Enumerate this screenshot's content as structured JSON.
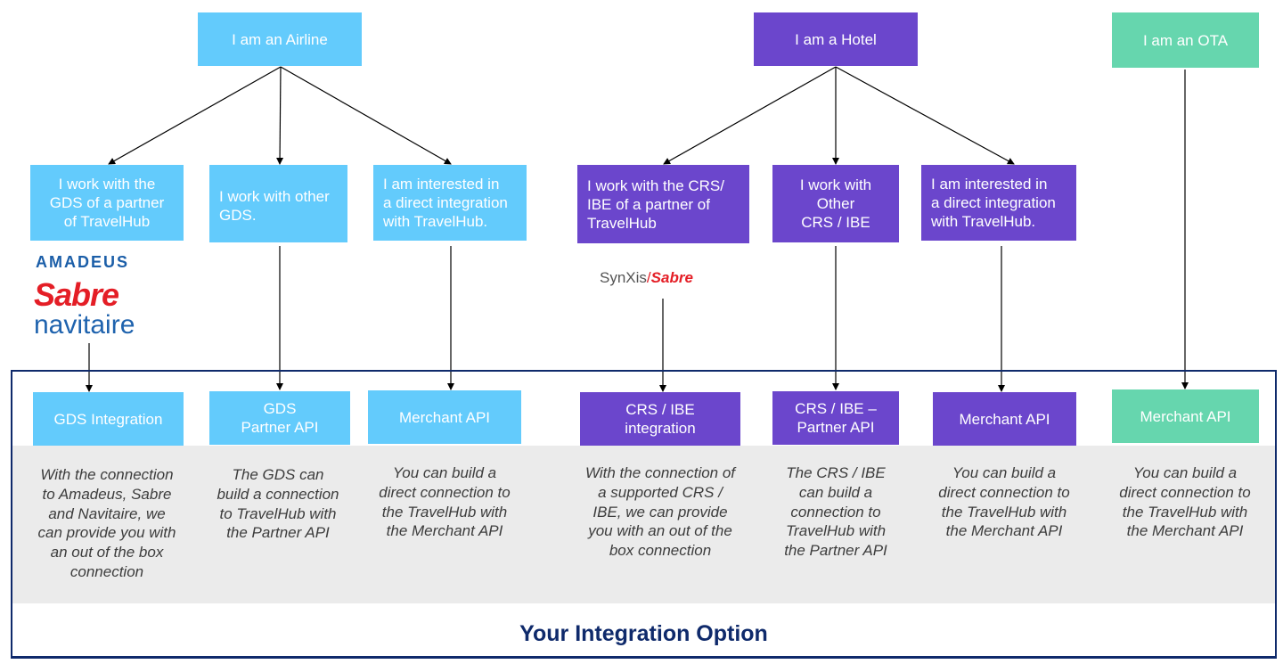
{
  "colors": {
    "airline": "#63cbfc",
    "hotel": "#6b46cc",
    "ota": "#66d6ae",
    "panel": "#ebebeb",
    "frame": "#0f2a6b",
    "logo_red": "#e41e26",
    "logo_blue": "#1b5ea8"
  },
  "roots": {
    "airline": "I am an Airline",
    "hotel": "I am a Hotel",
    "ota": "I am an OTA"
  },
  "situations": {
    "airline_partner_gds": [
      "I work with the",
      "GDS of a partner",
      "of TravelHub"
    ],
    "airline_other_gds": [
      "I work with other",
      "GDS."
    ],
    "airline_direct": [
      "I am interested in",
      "a direct integration",
      "with TravelHub."
    ],
    "hotel_partner_crs": [
      "I work with the CRS/",
      "IBE of a partner of",
      "TravelHub"
    ],
    "hotel_other_crs": [
      "I work with",
      "Other",
      "CRS / IBE"
    ],
    "hotel_direct": [
      "I am interested in",
      "a direct integration",
      "with TravelHub."
    ]
  },
  "logos": {
    "amadeus": "amadeus",
    "sabre": "Sabre",
    "navitaire": "navitaire",
    "synxis": "SynXis",
    "synxis_slash": "/",
    "synxis_sabre": "Sabre"
  },
  "options": [
    {
      "title": [
        "GDS Integration"
      ],
      "description": [
        "With the connection",
        "to Amadeus, Sabre",
        "and Navitaire, we",
        "can provide you with",
        "an out of the box",
        "connection"
      ]
    },
    {
      "title": [
        "GDS",
        "Partner API"
      ],
      "description": [
        "The GDS can",
        "build a connection",
        "to TravelHub with",
        "the Partner API"
      ]
    },
    {
      "title": [
        "Merchant API"
      ],
      "description": [
        "You can build a",
        "direct connection to",
        "the TravelHub with",
        "the Merchant API"
      ]
    },
    {
      "title": [
        "CRS / IBE",
        "integration"
      ],
      "description": [
        "With the connection of",
        "a supported CRS /",
        "IBE, we can provide",
        "you with an out of the",
        "box connection"
      ]
    },
    {
      "title": [
        "CRS / IBE –",
        "Partner API"
      ],
      "description": [
        "The CRS / IBE",
        "can build a",
        "connection to",
        "TravelHub with",
        "the Partner API"
      ]
    },
    {
      "title": [
        "Merchant API"
      ],
      "description": [
        "You can build a",
        "direct connection to",
        "the TravelHub with",
        "the Merchant API"
      ]
    },
    {
      "title": [
        "Merchant API"
      ],
      "description": [
        "You can build a",
        "direct connection to",
        "the TravelHub with",
        "the Merchant API"
      ]
    }
  ],
  "footer": {
    "title": "Your Integration Option"
  }
}
